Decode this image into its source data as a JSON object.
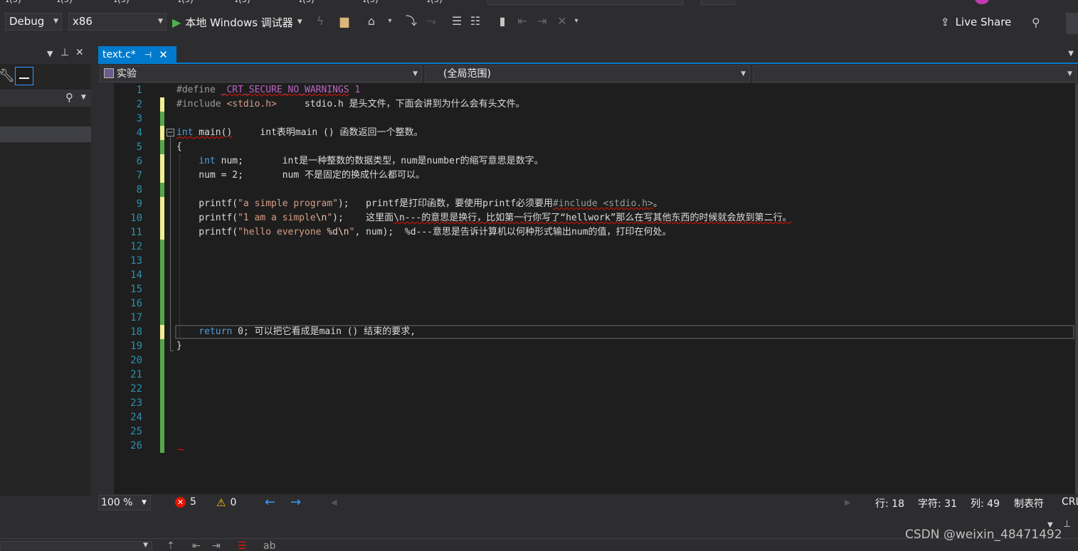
{
  "toolbar": {
    "config": "Debug",
    "platform": "x86",
    "run_label": "本地 Windows 调试器",
    "live_share": "Live Share"
  },
  "tab": {
    "name": "text.c*",
    "pin_glyph": "⊣",
    "close_glyph": "✕"
  },
  "nav": {
    "project": "实验",
    "scope": "(全局范围)"
  },
  "editor": {
    "line_numbers": [
      "1",
      "2",
      "3",
      "4",
      "5",
      "6",
      "7",
      "8",
      "9",
      "10",
      "11",
      "12",
      "13",
      "14",
      "15",
      "16",
      "17",
      "18",
      "19",
      "20",
      "21",
      "22",
      "23",
      "24",
      "25",
      "26"
    ],
    "lines": {
      "l1_pp": "#define ",
      "l1_macro": "_CRT_SECURE_NO_WARNINGS",
      "l1_val": " 1",
      "l2_pp": "#include ",
      "l2_hdr": "<stdio.h>",
      "l2_cmt": "     stdio.h 是头文件，下面会讲到为什么会有头文件。",
      "l4_kw": "int",
      "l4_fn": " main()",
      "l4_cmt": "     int表明main () 函数返回一个整数。",
      "l5": "{",
      "l6_kw": "    int",
      "l6_rest": " num;       int是一种整数的数据类型，num是number的缩写意思是数字。",
      "l7": "    num = 2;       num 不是固定的换成什么都可以。",
      "l9_a": "    printf(",
      "l9_str": "\"a simple program\"",
      "l9_b": ");   printf是打印函数，要使用printf必须要用",
      "l9_inc": "#include <stdio.h>",
      "l9_c": "。",
      "l10_a": "    printf(",
      "l10_str": "\"1 am a simple",
      "l10_esc": "\\n",
      "l10_str2": "\"",
      "l10_b": ");    这里面",
      "l10_c": "\\n---的意思是换行，比如第一行你写了“hellwork”那么在写其他东西的时候就会放到第二行。",
      "l11_a": "    printf(",
      "l11_str": "\"hello everyone ",
      "l11_esc": "%d\\n",
      "l11_str2": "\"",
      "l11_b": ", num);  %d---意思是告诉计算机以何种形式输出num的值，打印在何处。",
      "l18_kw": "    return",
      "l18_rest": " 0; 可以把它看成是main () 结束的要求,",
      "l19": "}"
    }
  },
  "status": {
    "zoom": "100 %",
    "errors": "5",
    "warnings": "0",
    "row": "行: 18",
    "char": "字符: 31",
    "col": "列: 49",
    "tab_mode": "制表符",
    "eol": "CRL"
  },
  "watermark": "CSDN @weixin_48471492"
}
